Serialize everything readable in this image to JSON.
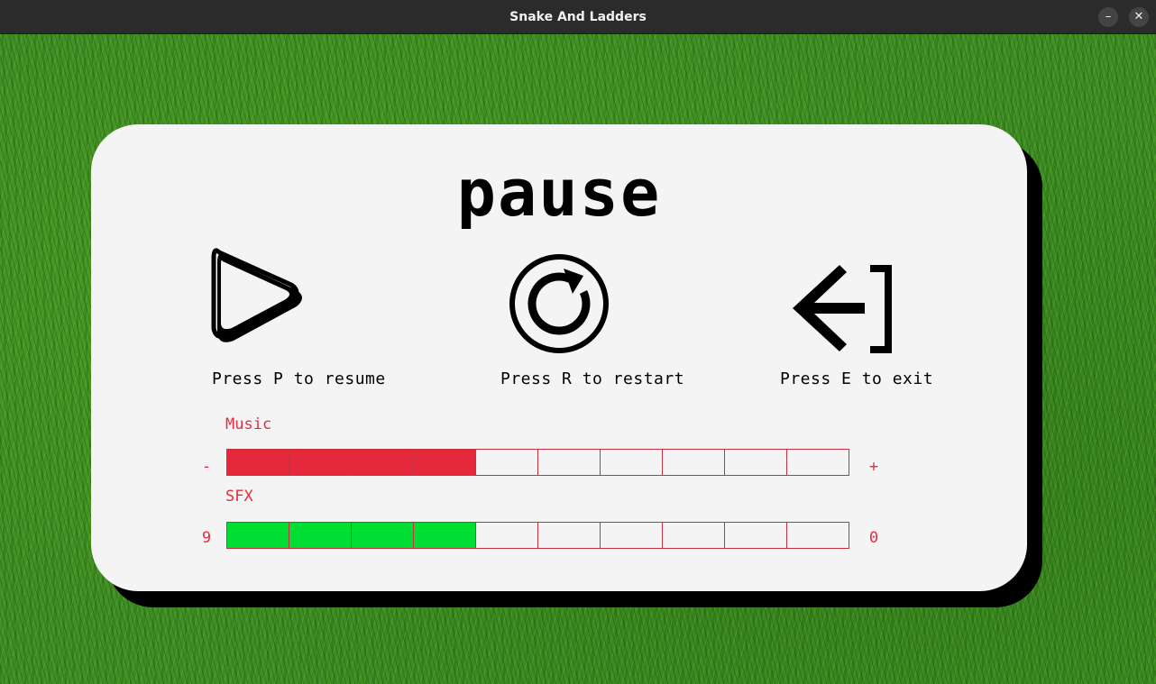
{
  "window": {
    "title": "Snake And Ladders",
    "minimize_label": "–",
    "close_label": "✕"
  },
  "pause_menu": {
    "title": "pause",
    "actions": [
      {
        "icon": "play-icon",
        "label": "Press P to resume"
      },
      {
        "icon": "restart-icon",
        "label": "Press R to restart"
      },
      {
        "icon": "exit-icon",
        "label": "Press E to exit"
      }
    ],
    "music": {
      "label": "Music",
      "left": "-",
      "right": "+",
      "level": 4,
      "segments": 10,
      "fill_color": "#e5283c"
    },
    "sfx": {
      "label": "SFX",
      "left": "9",
      "right": "0",
      "level": 4,
      "segments": 10,
      "fill_color": "#00dd33"
    }
  },
  "colors": {
    "accent": "#e0303f",
    "panel": "#f4f4f4",
    "grass": "#3f8f24"
  }
}
